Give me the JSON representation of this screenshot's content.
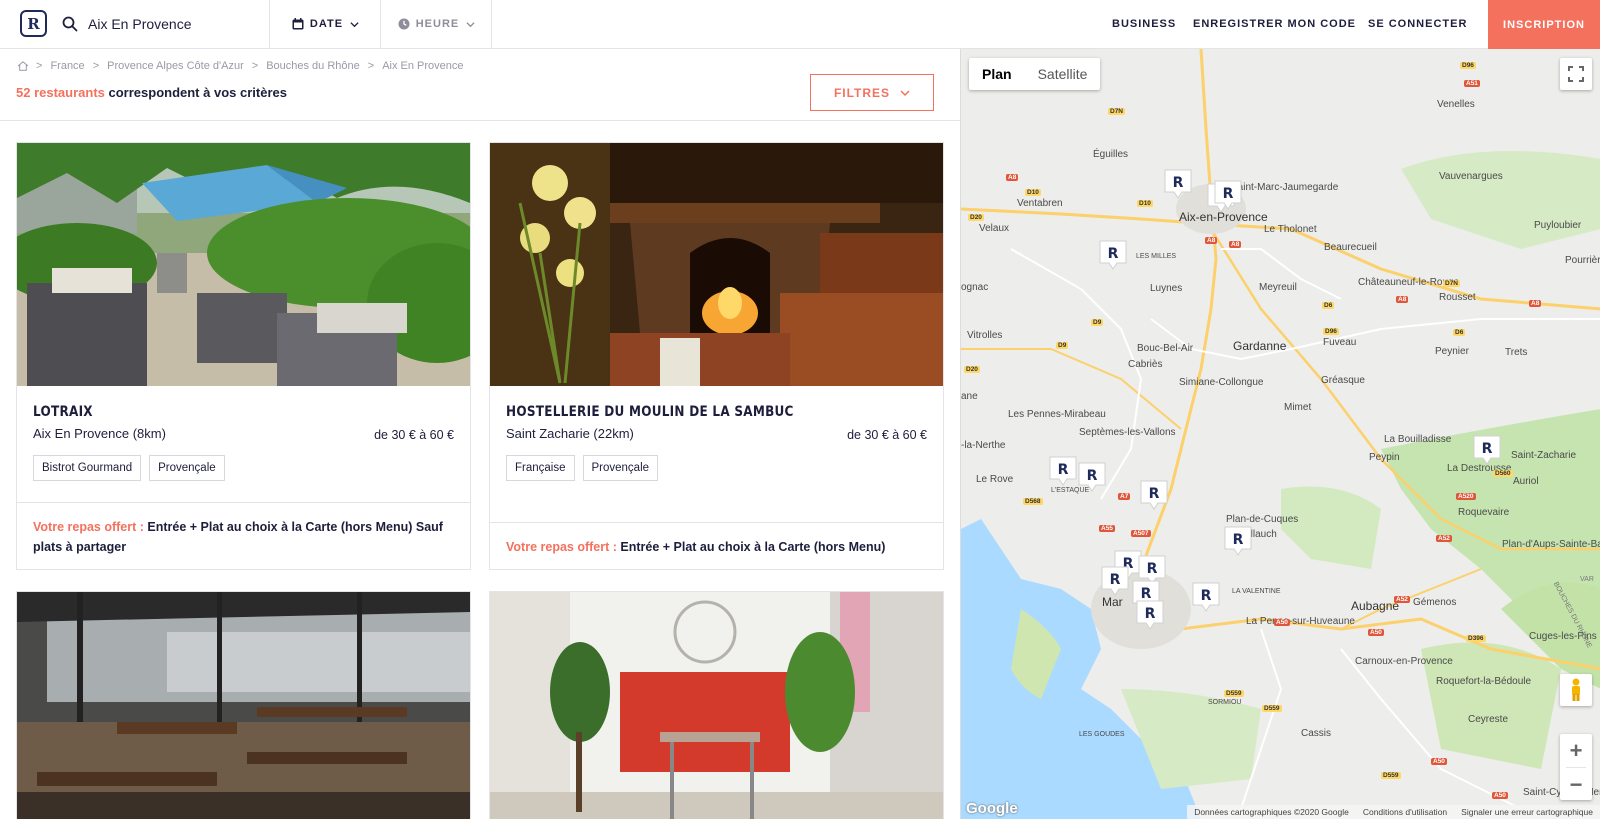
{
  "header": {
    "logo_letter": "R",
    "search_value": "Aix En Provence",
    "date_label": "DATE",
    "heure_label": "HEURE",
    "nav": {
      "business": "BUSINESS",
      "code": "ENREGISTRER MON CODE",
      "connect": "SE CONNECTER",
      "inscription": "INSCRIPTION"
    },
    "accent_color": "#f4715e"
  },
  "breadcrumb": [
    "France",
    "Provence Alpes Côte d'Azur",
    "Bouches du Rhône",
    "Aix En Provence"
  ],
  "results": {
    "count_number": "52 restaurants",
    "count_rest": " correspondent à vos critères",
    "filters_label": "FILTRES"
  },
  "restaurants": [
    {
      "name": "LOTRAIX",
      "location": "Aix En Provence (8km)",
      "price": "de 30 € à 60 €",
      "tags": [
        "Bistrot Gourmand",
        "Provençale"
      ],
      "offer_label": "Votre repas offert :",
      "offer_text": " Entrée + Plat au choix à la Carte (hors Menu) Sauf plats à partager"
    },
    {
      "name": "HOSTELLERIE DU MOULIN DE LA SAMBUC",
      "location": "Saint Zacharie (22km)",
      "price": "de 30 € à 60 €",
      "tags": [
        "Française",
        "Provençale"
      ],
      "offer_label": "Votre repas offert :",
      "offer_text": " Entrée + Plat au choix à la Carte (hors Menu)"
    }
  ],
  "map": {
    "type_plan": "Plan",
    "type_satellite": "Satellite",
    "zoom_in": "+",
    "zoom_out": "−",
    "google": "Google",
    "attribution": {
      "data": "Données cartographiques ©2020 Google",
      "terms": "Conditions d'utilisation",
      "report": "Signaler une erreur cartographique"
    },
    "pin_letter": "R",
    "towns": {
      "venelles": "Venelles",
      "eguilles": "Éguilles",
      "smj": "Saint-Marc-Jaumegarde",
      "vauvenargues": "Vauvenargues",
      "ventabren": "Ventabren",
      "aix": "Aix-en-Provence",
      "tholonet": "Le Tholonet",
      "puyloubier": "Puyloubier",
      "velaux": "Velaux",
      "beaurecueil": "Beaurecueil",
      "milles": "LES MILLES",
      "pourrieres": "Pourrières",
      "chateauneuf": "Châteauneuf-le-Rouge",
      "luynes": "Luynes",
      "meyreuil": "Meyreuil",
      "rousset": "Rousset",
      "rognac": "ognac",
      "vitrolles": "Vitrolles",
      "fuveau": "Fuveau",
      "peynier": "Peynier",
      "trets": "Trets",
      "gardanne": "Gardanne",
      "bouc": "Bouc-Bel-Air",
      "cabries": "Cabriès",
      "simiane": "Simiane-Collongue",
      "greasque": "Gréasque",
      "lespennes": "Les Pennes-Mirabeau",
      "mimet": "Mimet",
      "anne": "ane",
      "septemes": "Septèmes-les-Vallons",
      "bouilladisse": "La Bouilladisse",
      "nerthe": "-la-Nerthe",
      "peypin": "Peypin",
      "destrousse": "La Destrousse",
      "stzacharie": "Saint-Zacharie",
      "lerove": "Le Rove",
      "estaque": "L'ESTAQUE",
      "auriol": "Auriol",
      "cuques": "Plan-de-Cuques",
      "allauch": "Allauch",
      "roquevaire": "Roquevaire",
      "aups": "Plan-d'Aups-Sainte-Baume",
      "valentine": "LA VALENTINE",
      "aubagne": "Aubagne",
      "gemenos": "Gémenos",
      "penne": "La Penne-sur-Huveaune",
      "cuges": "Cuges-les-Pins",
      "marseille": "Mar",
      "carnoux": "Carnoux-en-Provence",
      "roquefort": "Roquefort-la-Bédoule",
      "sormiou": "SORMIOU",
      "ceyreste": "Ceyreste",
      "goudes": "LES GOUDES",
      "cassis": "Cassis",
      "cyr": "Saint-Cyr-sur-Mer",
      "bouches": "BOUCHES DU RHÔNE",
      "var": "VAR"
    },
    "roads": {
      "d96a": "D96",
      "a51a": "A51",
      "d7na": "D7N",
      "a8a": "A8",
      "d10a": "D10",
      "d10b": "D10",
      "d20a": "D20",
      "a8b": "A8",
      "a8c": "A8",
      "d6a": "D6",
      "a8d": "A8",
      "d7nb": "D7N",
      "a8e": "A8",
      "d9": "D9",
      "d96b": "D96",
      "d6b": "D6",
      "d9b": "D9",
      "d20b": "D20",
      "a7": "A7",
      "d568": "D568",
      "a55": "A55",
      "a507": "A507",
      "a520": "A520",
      "d560": "D560",
      "a52": "A52",
      "a50a": "A50",
      "a50b": "A50",
      "a52b": "A52",
      "d396": "D396",
      "d559": "D559",
      "d559b": "D559",
      "a50c": "A50",
      "d559c": "D559",
      "a50d": "A50"
    }
  }
}
